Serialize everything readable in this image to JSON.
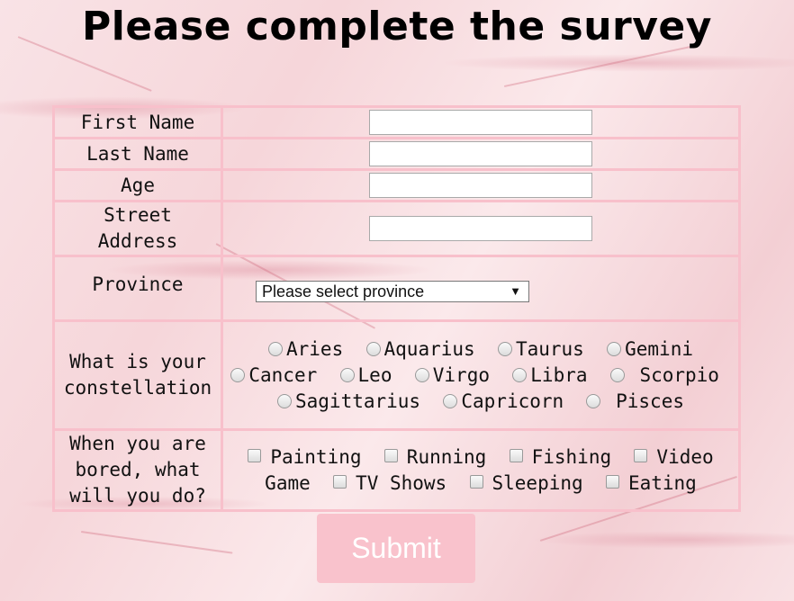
{
  "title": "Please complete the survey",
  "fields": {
    "first_name": {
      "label": "First Name",
      "value": ""
    },
    "last_name": {
      "label": "Last Name",
      "value": ""
    },
    "age": {
      "label": "Age",
      "value": ""
    },
    "street_address": {
      "label_line1": "Street",
      "label_line2": "Address",
      "value": ""
    }
  },
  "province": {
    "label": "Province",
    "selected": "Please select province"
  },
  "constellation": {
    "label_line1": "What is your",
    "label_line2": "constellation",
    "options": [
      "Aries",
      "Aquarius",
      "Taurus",
      "Gemini",
      "Cancer",
      "Leo",
      "Virgo",
      "Libra",
      "Scorpio",
      "Sagittarius",
      "Capricorn",
      "Pisces"
    ]
  },
  "hobbies": {
    "label_line1": "When you are",
    "label_line2": "bored, what",
    "label_line3": "will you do?",
    "options": [
      "Painting",
      "Running",
      "Fishing",
      "Video Game",
      "TV Shows",
      "Sleeping",
      "Eating"
    ]
  },
  "submit_label": "Submit",
  "colors": {
    "table_border": "#f8c0cb",
    "submit_bg": "#f9c2cc",
    "submit_text": "#ffffff"
  }
}
